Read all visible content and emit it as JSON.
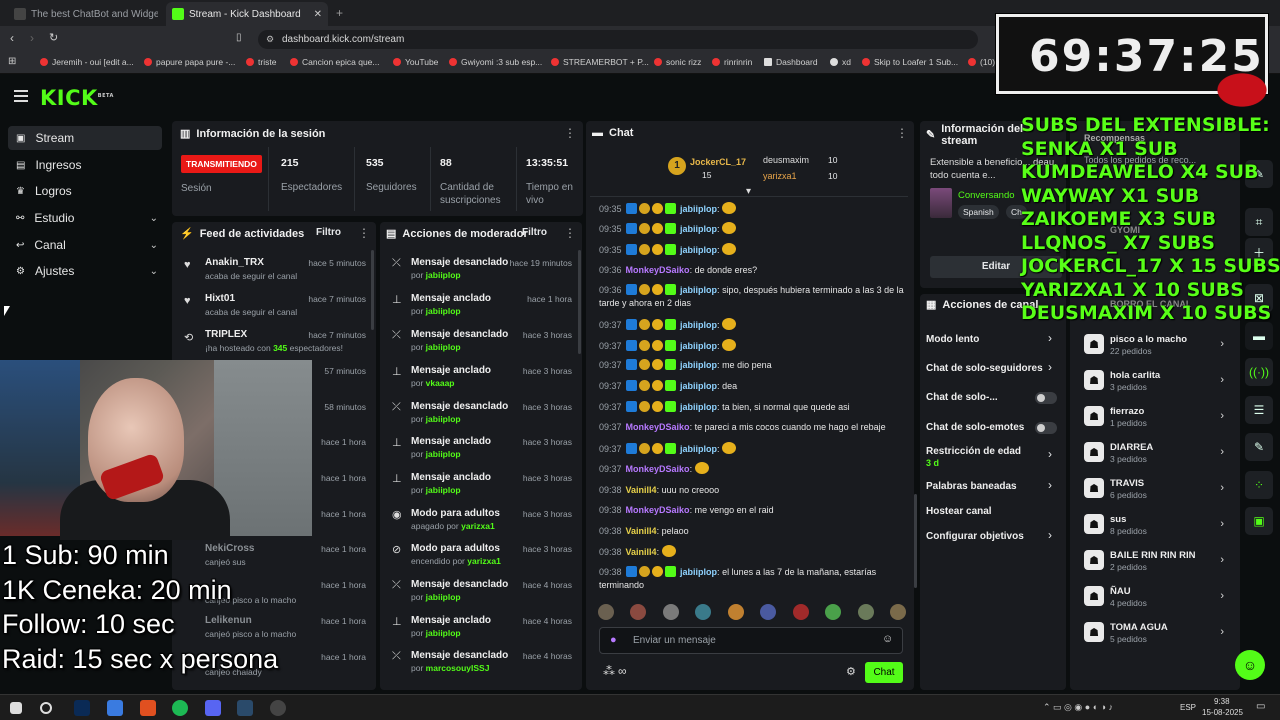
{
  "browser": {
    "tabs": [
      {
        "title": "The best ChatBot and Widgets for Ki"
      },
      {
        "title": "Stream - Kick Dashboard"
      }
    ],
    "url": "dashboard.kick.com/stream",
    "bookmarks": [
      "Jeremih - oui [edit a...",
      "papure papa pure -...",
      "triste",
      "Cancion epica que...",
      "YouTube",
      "Gwiyomi :3 sub esp...",
      "STREAMERBOT + P...",
      "sonic rizz",
      "rinrinrin",
      "Dashboard",
      "xd",
      "Skip to Loafer 1 Sub...",
      "(10)"
    ]
  },
  "app": {
    "logo": "KICK",
    "logo_sup": "BETA"
  },
  "sidebar": {
    "items": [
      {
        "label": "Stream"
      },
      {
        "label": "Ingresos"
      },
      {
        "label": "Logros"
      },
      {
        "label": "Estudio"
      },
      {
        "label": "Canal"
      },
      {
        "label": "Ajustes"
      }
    ]
  },
  "session": {
    "title": "Información de la sesión",
    "live_badge": "TRANSMITIENDO",
    "live_label": "Sesión",
    "stats": [
      {
        "value": "215",
        "label": "Espectadores"
      },
      {
        "value": "535",
        "label": "Seguidores"
      },
      {
        "value": "88",
        "label": "Cantidad de suscripciones"
      },
      {
        "value": "13:35:51",
        "label": "Tiempo en vivo"
      }
    ]
  },
  "feed": {
    "title": "Feed de actividades",
    "filter": "Filtro",
    "items": [
      {
        "name": "Anakin_TRX",
        "sub": "acaba de seguir el canal",
        "time": "hace 5 minutos"
      },
      {
        "name": "Hixt01",
        "sub": "acaba de seguir el canal",
        "time": "hace 7 minutos"
      },
      {
        "name": "TRIPLEX",
        "sub_pre": "¡ha hosteado con ",
        "sub_num": "345",
        "sub_post": " espectadores!",
        "time": "hace 7 minutos"
      },
      {
        "time": "57 minutos"
      },
      {
        "time": "58 minutos"
      },
      {
        "time": "hace 1 hora"
      },
      {
        "time": "hace 1 hora"
      },
      {
        "time": "hace 1 hora"
      },
      {
        "name": "NekiCross",
        "sub": "canjeó sus",
        "time": "hace 1 hora"
      },
      {
        "sub": "canjeó pisco a lo macho",
        "time": "hace 1 hora"
      },
      {
        "name": "Lelikenun",
        "sub": "canjeó pisco a lo macho",
        "time": "hace 1 hora"
      },
      {
        "sub": "canjeó chaiady",
        "time": "hace 1 hora"
      }
    ]
  },
  "mod": {
    "title": "Acciones de moderador",
    "filter": "Filtro",
    "items": [
      {
        "action": "Mensaje desanclado",
        "by": "por",
        "user": "jabiiplop",
        "time": "hace 19 minutos"
      },
      {
        "action": "Mensaje anclado",
        "by": "por",
        "user": "jabiiplop",
        "time": "hace 1 hora"
      },
      {
        "action": "Mensaje desanclado",
        "by": "por",
        "user": "jabiiplop",
        "time": "hace 3 horas"
      },
      {
        "action": "Mensaje anclado",
        "by": "por",
        "user": "vkaaap",
        "time": "hace 3 horas"
      },
      {
        "action": "Mensaje desanclado",
        "by": "por",
        "user": "jabiiplop",
        "time": "hace 3 horas"
      },
      {
        "action": "Mensaje anclado",
        "by": "por",
        "user": "jabiiplop",
        "time": "hace 3 horas"
      },
      {
        "action": "Mensaje anclado",
        "by": "por",
        "user": "jabiiplop",
        "time": "hace 3 horas"
      },
      {
        "action": "Modo para adultos",
        "by": "apagado por",
        "user": "yarizxa1",
        "time": "hace 3 horas"
      },
      {
        "action": "Modo para adultos",
        "by": "encendido por",
        "user": "yarizxa1",
        "time": "hace 3 horas"
      },
      {
        "action": "Mensaje desanclado",
        "by": "por",
        "user": "jabiiplop",
        "time": "hace 4 horas"
      },
      {
        "action": "Mensaje anclado",
        "by": "por",
        "user": "jabiiplop",
        "time": "hace 4 horas"
      },
      {
        "action": "Mensaje desanclado",
        "by": "por",
        "user": "marcosouyISSJ",
        "time": "hace 4 horas"
      }
    ]
  },
  "chat": {
    "title": "Chat",
    "gifters": [
      {
        "name": "JockerCL_17",
        "count": "15"
      },
      {
        "name": "deusmaxim",
        "count": "10"
      },
      {
        "name": "yarizxa1",
        "count": "10"
      }
    ],
    "messages": [
      {
        "time": "09:35",
        "user": "jabiiplop",
        "text": "",
        "emote": true,
        "badges": true
      },
      {
        "time": "09:35",
        "user": "jabiiplop",
        "text": "",
        "emote": true,
        "badges": true
      },
      {
        "time": "09:35",
        "user": "jabiiplop",
        "text": "",
        "emote": true,
        "badges": true
      },
      {
        "time": "09:36",
        "user": "MonkeyDSaiko",
        "text": "de donde eres?",
        "ucls": "un2"
      },
      {
        "time": "09:36",
        "user": "jabiiplop",
        "text": "sipo, después hubiera terminado a las 3 de la tarde y ahora en 2 dias",
        "badges": true,
        "two": true
      },
      {
        "time": "09:37",
        "user": "jabiiplop",
        "text": "",
        "emote": true,
        "badges": true
      },
      {
        "time": "09:37",
        "user": "jabiiplop",
        "text": "",
        "emote": true,
        "badges": true
      },
      {
        "time": "09:37",
        "user": "jabiiplop",
        "text": "me dio pena",
        "badges": true
      },
      {
        "time": "09:37",
        "user": "jabiiplop",
        "text": "dea",
        "badges": true
      },
      {
        "time": "09:37",
        "user": "jabiiplop",
        "text": "ta bien, si normal que quede asi",
        "badges": true
      },
      {
        "time": "09:37",
        "user": "MonkeyDSaiko",
        "text": "te pareci a mis cocos cuando me hago el rebaje",
        "ucls": "un2"
      },
      {
        "time": "09:37",
        "user": "jabiiplop",
        "text": "",
        "emote": true,
        "badges": true
      },
      {
        "time": "09:37",
        "user": "MonkeyDSaiko",
        "text": "",
        "emote": true,
        "ucls": "un2"
      },
      {
        "time": "09:38",
        "user": "Vainill4",
        "text": "uuu no creooo",
        "ucls": "un3"
      },
      {
        "time": "09:38",
        "user": "MonkeyDSaiko",
        "text": "me vengo en el raid",
        "ucls": "un2"
      },
      {
        "time": "09:38",
        "user": "Vainill4",
        "text": "pelaoo",
        "ucls": "un3"
      },
      {
        "time": "09:38",
        "user": "Vainill4",
        "text": "",
        "emote": true,
        "ucls": "un3"
      },
      {
        "time": "09:38",
        "user": "jabiiplop",
        "text": "el lunes a las 7 de la mañana, estarías terminando",
        "badges": true,
        "two": true
      }
    ],
    "placeholder": "Enviar un mensaje",
    "send": "Chat"
  },
  "stream_info": {
    "title": "Información del stream",
    "desc": "Extensible a beneficio... deau, todo cuenta e...",
    "status": "Conversando",
    "lang": "Spanish",
    "tag2": "Ch",
    "edit": "Editar"
  },
  "channel_actions": {
    "title": "Acciones de canal",
    "items": [
      {
        "label": "Modo lento",
        "type": "chev"
      },
      {
        "label": "Chat de solo-seguidores",
        "type": "chev"
      },
      {
        "label": "Chat de solo-...",
        "type": "toggle"
      },
      {
        "label": "Chat de solo-emotes",
        "type": "toggle"
      },
      {
        "label": "Restricción de edad",
        "sub": "3 d",
        "type": "chev"
      },
      {
        "label": "Palabras baneadas",
        "type": "chev"
      },
      {
        "label": "Hostear canal",
        "type": "none"
      },
      {
        "label": "Configurar objetivos",
        "type": "chev"
      }
    ]
  },
  "rewards": {
    "header": "Recompensas",
    "pending": "Todos los pedidos de reco...",
    "partial": [
      "GYOMI",
      "BORRO EL CANAL"
    ],
    "items": [
      {
        "name": "pisco a lo macho",
        "count": "22 pedidos"
      },
      {
        "name": "hola carlita",
        "count": "3 pedidos"
      },
      {
        "name": "fierrazo",
        "count": "1 pedidos"
      },
      {
        "name": "DIARREA",
        "count": "3 pedidos"
      },
      {
        "name": "TRAVIS",
        "count": "6 pedidos"
      },
      {
        "name": "sus",
        "count": "8 pedidos"
      },
      {
        "name": "BAILE RIN RIN RIN",
        "count": "2 pedidos"
      },
      {
        "name": "ÑAU",
        "count": "4 pedidos"
      },
      {
        "name": "TOMA AGUA",
        "count": "5 pedidos"
      }
    ]
  },
  "overlay": {
    "timer": "69:37:25",
    "subs_lines": [
      "SUBS DEL EXTENSIBLE:",
      "SENKA X1 SUB",
      "KUMDEAWELO X4 SUB",
      "WAYWAY X1 SUB",
      "ZAIKOEME X3 SUB",
      "LLQNOS_ X7 SUBS",
      "JOCKERCL_17 X 15 SUBS",
      "YARIZXA1 X 10 SUBS",
      "DEUSMAXIM X 10 SUBS"
    ],
    "rules": [
      "1 Sub: 90 min",
      "1K Ceneka: 20 min",
      "Follow: 10 sec",
      "Raid: 15 sec x persona"
    ]
  },
  "taskbar": {
    "lang": "ESP",
    "time": "9:38",
    "date": "15-08-2025"
  },
  "colors": {
    "accent": "#53fc18",
    "live": "#e91916",
    "panel": "#191b1f",
    "bg": "#0b0e0f"
  }
}
